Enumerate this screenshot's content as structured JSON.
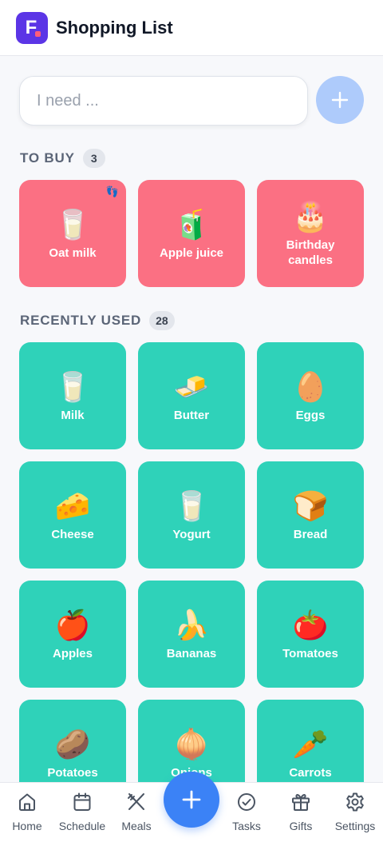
{
  "header": {
    "logo_letter": "F",
    "title": "Shopping List"
  },
  "search": {
    "placeholder": "I need ...",
    "value": "",
    "add_icon": "plus-icon"
  },
  "to_buy": {
    "title": "TO BUY",
    "count": "3",
    "items": [
      {
        "label": "Oat milk",
        "emoji": "🥛",
        "badge": "👣"
      },
      {
        "label": "Apple juice",
        "emoji": "🧃"
      },
      {
        "label": "Birthday candles",
        "emoji": "🎂"
      }
    ]
  },
  "recent": {
    "title": "RECENTLY USED",
    "count": "28",
    "items": [
      {
        "label": "Milk",
        "emoji": "🥛"
      },
      {
        "label": "Butter",
        "emoji": "🧈"
      },
      {
        "label": "Eggs",
        "emoji": "🥚"
      },
      {
        "label": "Cheese",
        "emoji": "🧀"
      },
      {
        "label": "Yogurt",
        "emoji": "🥛"
      },
      {
        "label": "Bread",
        "emoji": "🍞"
      },
      {
        "label": "Apples",
        "emoji": "🍎"
      },
      {
        "label": "Bananas",
        "emoji": "🍌"
      },
      {
        "label": "Tomatoes",
        "emoji": "🍅"
      },
      {
        "label": "Potatoes",
        "emoji": "🥔"
      },
      {
        "label": "Onions",
        "emoji": "🧅"
      },
      {
        "label": "Carrots",
        "emoji": "🥕"
      }
    ]
  },
  "nav": {
    "items": [
      {
        "label": "Home",
        "icon": "home-icon"
      },
      {
        "label": "Schedule",
        "icon": "calendar-icon"
      },
      {
        "label": "Meals",
        "icon": "utensils-icon"
      },
      {
        "label": "Tasks",
        "icon": "check-circle-icon"
      },
      {
        "label": "Gifts",
        "icon": "gift-icon"
      },
      {
        "label": "Settings",
        "icon": "gear-icon"
      }
    ],
    "fab_icon": "plus-icon"
  },
  "colors": {
    "accent": "#3b82f6",
    "brand": "#5b35e6",
    "to_buy_tile": "#fb7083",
    "recent_tile": "#2fd2b9"
  }
}
